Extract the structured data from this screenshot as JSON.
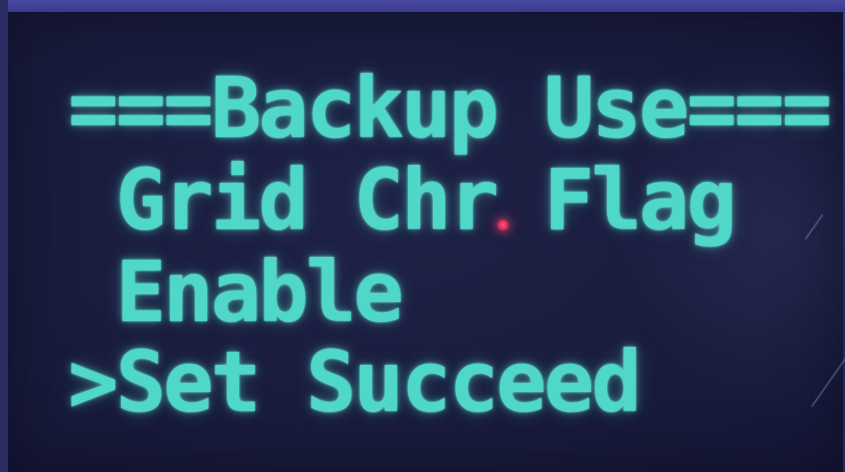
{
  "display": {
    "title_line": "===Backup Use===",
    "lines": [
      " Grid Chr Flag",
      " Enable",
      ">Set Succeed"
    ]
  },
  "colors": {
    "text": "#4fd8c8",
    "background": "#1b1d40",
    "indicator": "#e0406a"
  }
}
